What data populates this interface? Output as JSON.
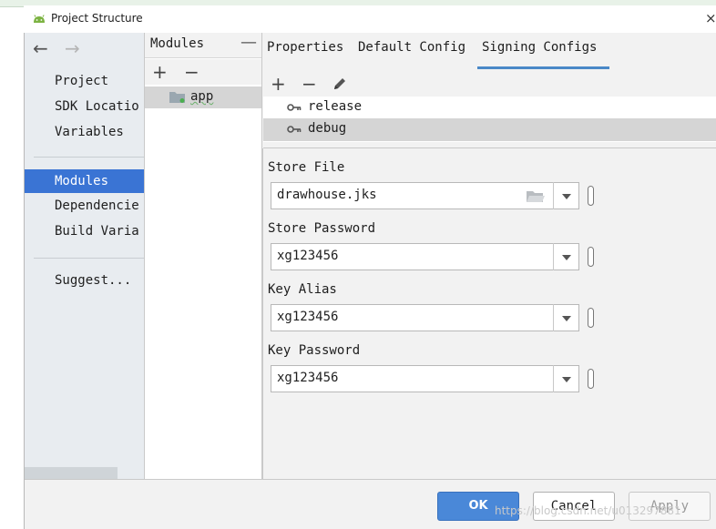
{
  "window": {
    "title": "Project Structure",
    "close_glyph": "×"
  },
  "sidebar": {
    "back_glyph": "←",
    "forward_glyph": "→",
    "items": [
      {
        "label": "Project"
      },
      {
        "label": "SDK Location"
      },
      {
        "label": "Variables"
      },
      {
        "label": "Modules",
        "selected": true
      },
      {
        "label": "Dependencies"
      },
      {
        "label": "Build Variants"
      },
      {
        "label": "Suggestions"
      }
    ],
    "visible_labels": [
      "Project",
      "SDK Locatio",
      "Variables",
      "Modules",
      "Dependencie",
      "Build Varia",
      "Suggest..."
    ]
  },
  "modules": {
    "title": "Modules",
    "collapse_glyph": "—",
    "add_glyph": "+",
    "remove_glyph": "−",
    "items": [
      {
        "label": "app",
        "selected": true
      }
    ]
  },
  "tabs": [
    {
      "label": "Properties",
      "active": false
    },
    {
      "label": "Default Config",
      "active": false
    },
    {
      "label": "Signing Configs",
      "active": true
    }
  ],
  "signing_configs": {
    "add_glyph": "+",
    "remove_glyph": "−",
    "edit_icon": "pencil-icon",
    "items": [
      {
        "label": "release",
        "icon": "key-icon",
        "selected": false
      },
      {
        "label": "debug",
        "icon": "key-icon",
        "selected": true
      }
    ]
  },
  "form": {
    "store_file": {
      "label": "Store File",
      "value": "drawhouse.jks"
    },
    "store_password": {
      "label": "Store Password",
      "value": "xg123456"
    },
    "key_alias": {
      "label": "Key Alias",
      "value": "xg123456"
    },
    "key_password": {
      "label": "Key Password",
      "value": "xg123456"
    }
  },
  "buttons": {
    "ok": "OK",
    "cancel": "Cancel",
    "apply": "Apply"
  },
  "watermark": "https://blog.csdn.net/u013297881",
  "colors": {
    "accent": "#3a74d4",
    "ok_button": "#4a88d8",
    "tab_underline": "#4a88c7",
    "selection_gray": "#d5d5d5"
  }
}
